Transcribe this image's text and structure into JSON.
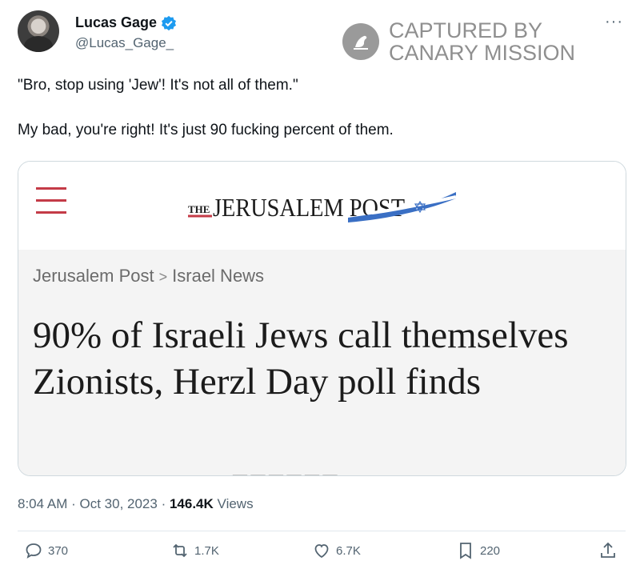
{
  "author": {
    "name": "Lucas Gage",
    "handle": "@Lucas_Gage_"
  },
  "watermark": {
    "line1": "CAPTURED BY",
    "line2": "CANARY MISSION"
  },
  "tweet": {
    "line1": "\"Bro, stop using 'Jew'! It's not all of them.\"",
    "line2": "My bad, you're right! It's just 90 fucking percent of them."
  },
  "card": {
    "masthead": "THE JERUSALEM POST",
    "breadcrumb_1": "Jerusalem Post",
    "breadcrumb_sep": ">",
    "breadcrumb_2": "Israel News",
    "headline": "90% of Israeli Jews call themselves Zionists, Herzl Day poll finds"
  },
  "meta": {
    "time": "8:04 AM",
    "date": "Oct 30, 2023",
    "views_count": "146.4K",
    "views_label": "Views"
  },
  "actions": {
    "replies": "370",
    "reposts": "1.7K",
    "likes": "6.7K",
    "bookmarks": "220"
  },
  "colors": {
    "verified": "#1d9bf0",
    "menu_red": "#c43b47",
    "text_muted": "#536471"
  }
}
